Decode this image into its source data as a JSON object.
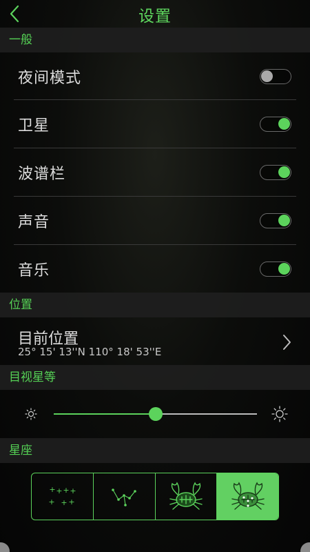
{
  "header": {
    "title": "设置"
  },
  "sections": {
    "general": "一般",
    "location": "位置",
    "magnitude": "目视星等",
    "constellation": "星座"
  },
  "toggles": [
    {
      "label": "夜间模式",
      "on": false
    },
    {
      "label": "卫星",
      "on": true
    },
    {
      "label": "波谱栏",
      "on": true
    },
    {
      "label": "声音",
      "on": true
    },
    {
      "label": "音乐",
      "on": true
    }
  ],
  "location": {
    "title": "目前位置",
    "coordinates": "25° 15' 13''N 110° 18' 53''E"
  },
  "magnitude_slider": {
    "value_fraction": 0.5
  },
  "constellation_modes": [
    "stars-icon",
    "lines-icon",
    "art-icon",
    "art-lines-icon"
  ],
  "constellation_selected": 3,
  "colors": {
    "accent": "#5cd35c",
    "header_bg": "#1e1e1e",
    "background": "#060606"
  }
}
